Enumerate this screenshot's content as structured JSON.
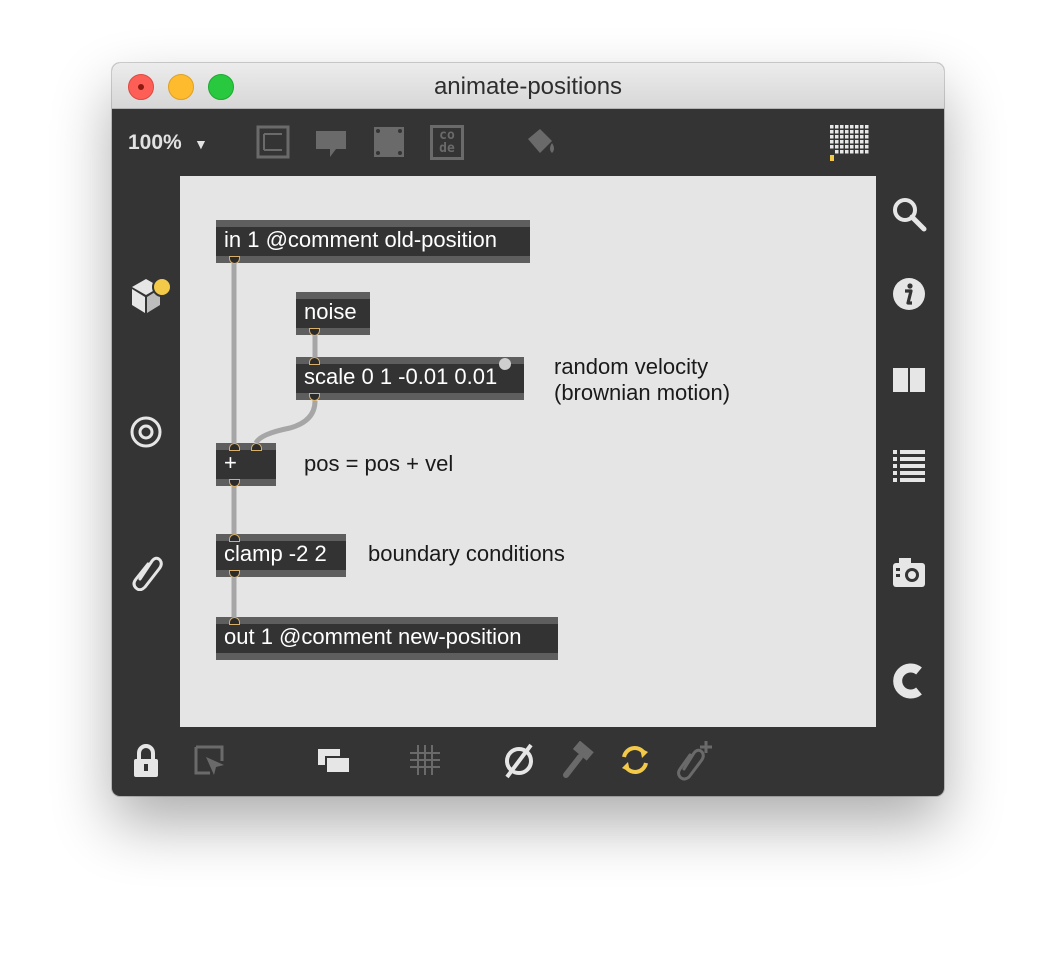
{
  "window": {
    "title": "animate-positions"
  },
  "toolbar": {
    "zoom": "100%",
    "zoom_arrow": "▼",
    "code_icon_text": [
      "co",
      "de"
    ]
  },
  "patch": {
    "objects": [
      {
        "id": "in1",
        "text": "in 1 @comment old-position"
      },
      {
        "id": "noise",
        "text": "noise"
      },
      {
        "id": "scale",
        "text": "scale 0 1 -0.01 0.01"
      },
      {
        "id": "plus",
        "text": "+"
      },
      {
        "id": "clamp",
        "text": "clamp -2 2"
      },
      {
        "id": "out1",
        "text": "out 1 @comment new-position"
      }
    ],
    "comments": {
      "velocity_line1": "random velocity",
      "velocity_line2": "(brownian motion)",
      "pos_formula": "pos = pos + vel",
      "boundary": "boundary conditions"
    }
  },
  "colors": {
    "sidebar_bg": "#343434",
    "canvas_bg": "#e5e5e5",
    "object_bg": "#333333",
    "accent_yellow": "#f3c94a",
    "icon_light": "#e6e6e6",
    "icon_dim": "#6a6a6a"
  },
  "icons": {
    "toolbar": [
      "presentation-icon",
      "comment-icon",
      "panel-icon",
      "code-icon",
      "paint-bucket-icon",
      "grid-dots-icon"
    ],
    "left_sidebar": [
      "object-cube-icon",
      "target-icon",
      "paperclip-icon"
    ],
    "right_sidebar": [
      "search-icon",
      "info-icon",
      "book-icon",
      "list-icon",
      "camera-icon",
      "c-icon"
    ],
    "bottom": [
      "lock-icon",
      "select-pointer-icon",
      "layers-icon",
      "grid-icon",
      "no-icon",
      "hammer-icon",
      "refresh-icon",
      "paperclip-add-icon"
    ]
  }
}
